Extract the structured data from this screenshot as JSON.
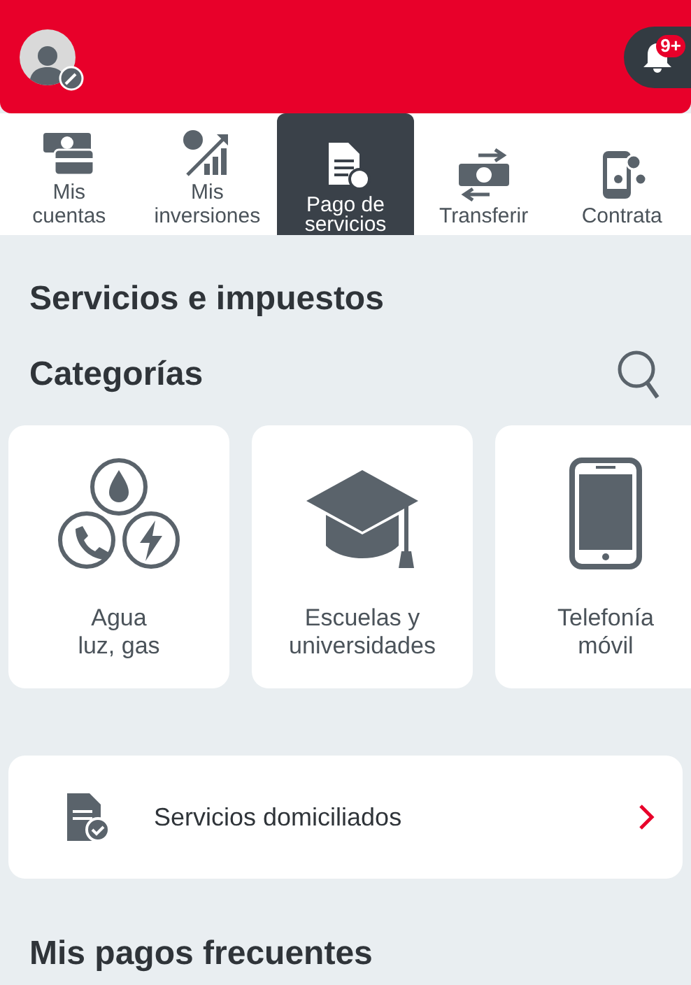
{
  "header": {
    "notifications_badge": "9+"
  },
  "tabs": [
    {
      "label": "Mis\ncuentas",
      "selected": false
    },
    {
      "label": "Mis\ninversiones",
      "selected": false
    },
    {
      "label": "Pago de\nservicios",
      "selected": true
    },
    {
      "label": "Transferir",
      "selected": false
    },
    {
      "label": "Contrata",
      "selected": false
    }
  ],
  "section_title": "Servicios e impuestos",
  "categories_title": "Categorías",
  "categories": [
    {
      "label": "Agua\nluz, gas"
    },
    {
      "label": "Escuelas y\nuniversidades"
    },
    {
      "label": "Telefonía\nmóvil"
    }
  ],
  "domiciled": {
    "label": "Servicios domiciliados"
  },
  "frequent_title": "Mis pagos frecuentes"
}
